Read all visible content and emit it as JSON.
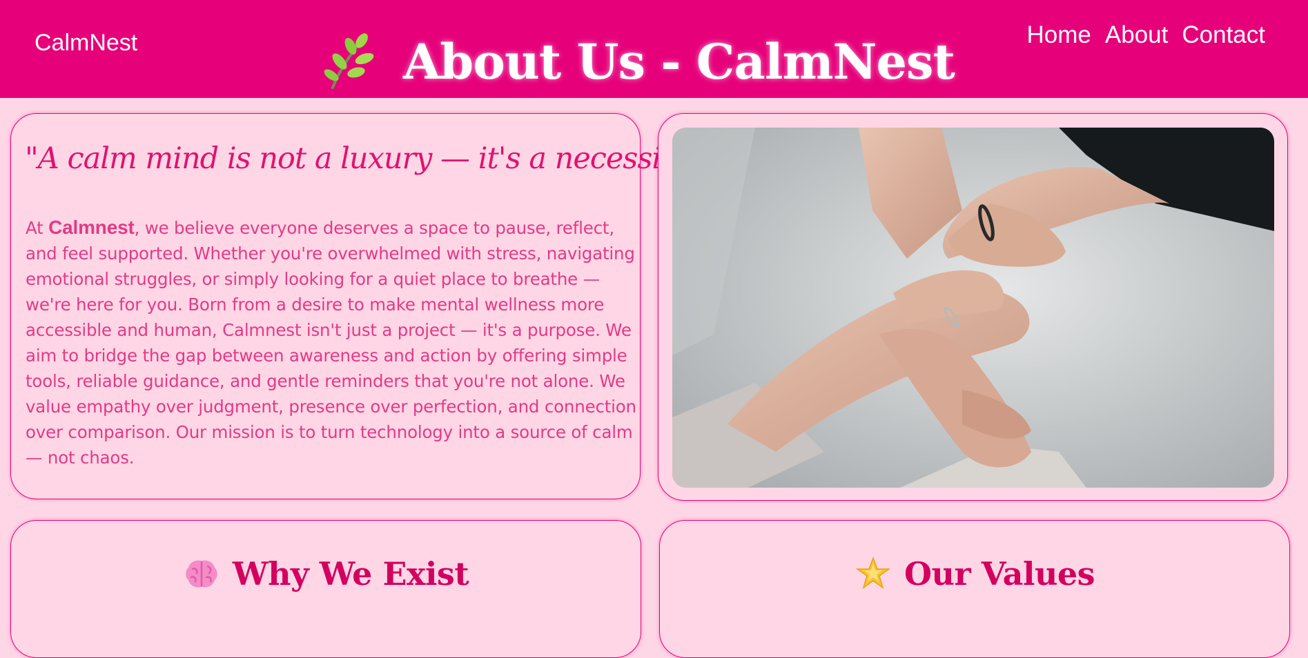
{
  "header": {
    "brand": "CalmNest",
    "title": "About Us - CalmNest",
    "title_icon": "leaf-icon",
    "nav": [
      "Home",
      "About",
      "Contact"
    ]
  },
  "about": {
    "quote": "\"A calm mind is not a luxury — it's a necessity.\"",
    "text_before": "At ",
    "brand_bold": "Calmnest",
    "text_after": ", we believe everyone deserves a space to pause, reflect, and feel supported. Whether you're overwhelmed with stress, navigating emotional struggles, or simply looking for a quiet place to breathe — we're here for you. Born from a desire to make mental wellness more accessible and human, Calmnest isn't just a project — it's a purpose. We aim to bridge the gap between awareness and action by offering simple tools, reliable guidance, and gentle reminders that you're not alone. We value empathy over judgment, presence over perfection, and connection over comparison. Our mission is to turn technology into a source of calm — not chaos."
  },
  "photo": {
    "subject": "hands-stacked-photo"
  },
  "sections": {
    "why": {
      "icon": "brain-icon",
      "title": "Why We Exist"
    },
    "values": {
      "icon": "star-icon",
      "title": "Our Values"
    }
  },
  "colors": {
    "header_bg": "#e6007a",
    "page_bg": "#ffd6e6",
    "accent_text": "#e0126f",
    "body_text": "#e23a86"
  }
}
